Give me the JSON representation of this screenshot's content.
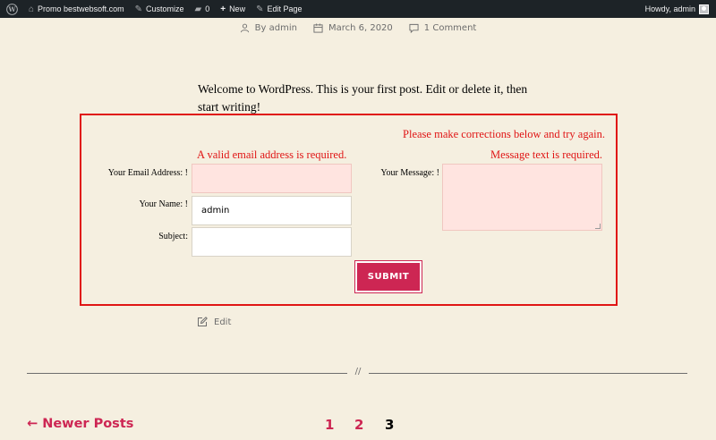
{
  "admin_bar": {
    "site_name": "Promo bestwebsoft.com",
    "customize": "Customize",
    "comments_count": "0",
    "new": "New",
    "edit_page": "Edit Page",
    "howdy": "Howdy, admin"
  },
  "meta": {
    "author": "By admin",
    "date": "March 6, 2020",
    "comments": "1 Comment"
  },
  "content": {
    "text": "Welcome to WordPress. This is your first post. Edit or delete it, then start writing!"
  },
  "form": {
    "top_error": "Please make corrections below and try again.",
    "email_error": "A valid email address is required.",
    "message_error": "Message text is required.",
    "email_label": "Your Email Address:",
    "name_label": "Your Name:",
    "subject_label": "Subject:",
    "message_label": "Your Message:",
    "required_mark": "!",
    "email_value": "",
    "name_value": "admin",
    "subject_value": "",
    "submit_label": "SUBMIT"
  },
  "edit_link": "Edit",
  "separator_mark": "//",
  "pagination": {
    "newer": "← Newer Posts",
    "pages": [
      "1",
      "2",
      "3"
    ],
    "current": "3"
  },
  "colors": {
    "accent": "#cd2653",
    "error": "#e01515",
    "background": "#f5efe0",
    "admin_bar": "#1d2327"
  }
}
